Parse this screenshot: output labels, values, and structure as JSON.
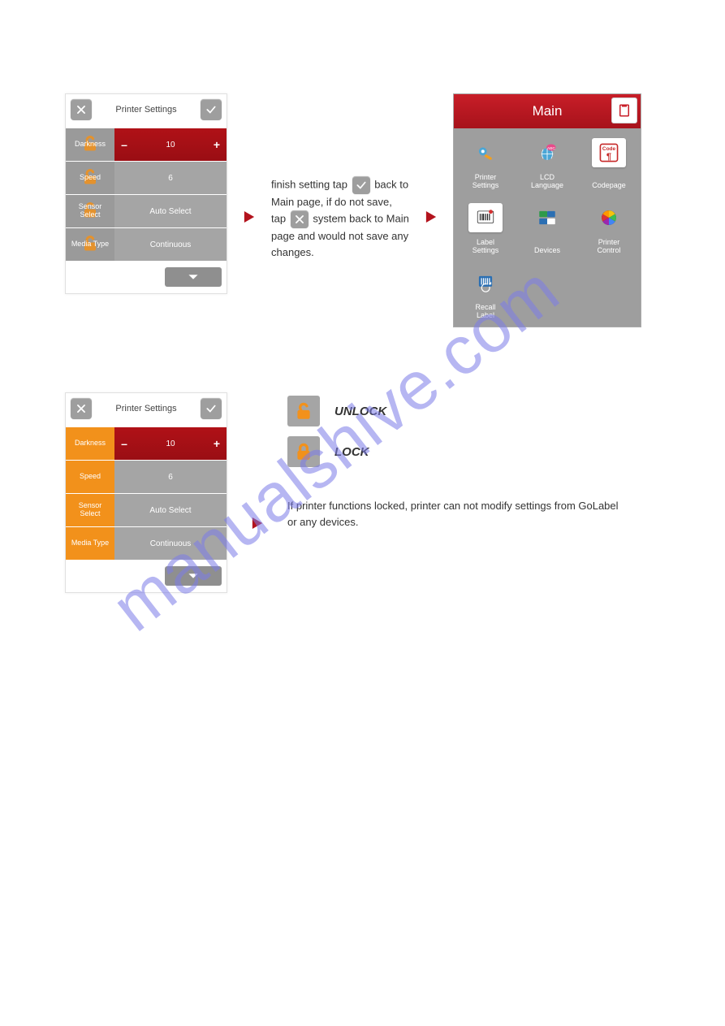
{
  "panelA": {
    "title": "Printer Settings",
    "rows": [
      {
        "label": "Darkness",
        "value": "10",
        "red": true,
        "minus": "–",
        "plus": "+"
      },
      {
        "label": "Speed",
        "value": "6",
        "red": false
      },
      {
        "label": "Sensor Select",
        "value": "Auto Select",
        "red": false
      },
      {
        "label": "Media Type",
        "value": "Continuous",
        "red": false
      }
    ]
  },
  "panelB": {
    "title": "Printer Settings",
    "rows": [
      {
        "label": "Darkness",
        "value": "10",
        "red": true,
        "minus": "–",
        "plus": "+"
      },
      {
        "label": "Speed",
        "value": "6",
        "red": false
      },
      {
        "label": "Sensor Select",
        "value": "Auto Select",
        "red": false
      },
      {
        "label": "Media Type",
        "value": "Continuous",
        "red": false
      }
    ]
  },
  "instruction": {
    "part1": "finish setting tap",
    "part2": "back to Main page,  if do not save, tap",
    "part3": "system back to Main page and would not save any changes."
  },
  "mainMenu": {
    "title": "Main",
    "tiles": [
      {
        "label": "Printer Settings",
        "icon": "gear-wrench-icon"
      },
      {
        "label": "LCD Language",
        "icon": "globe-abc-icon"
      },
      {
        "label": "Codepage",
        "icon": "code-pilcrow-icon"
      },
      {
        "label": "Label Settings",
        "icon": "barcode-icon"
      },
      {
        "label": "Devices",
        "icon": "devices-icon"
      },
      {
        "label": "Printer Control",
        "icon": "color-wheel-icon"
      },
      {
        "label": "Recall Label",
        "icon": "recall-label-icon"
      }
    ]
  },
  "legend": {
    "unlock": "UNLOCK",
    "lock": "LOCK",
    "note": "If printer functions locked, printer can not modify settings from GoLabel or any devices."
  },
  "watermark": "manualshive.com"
}
